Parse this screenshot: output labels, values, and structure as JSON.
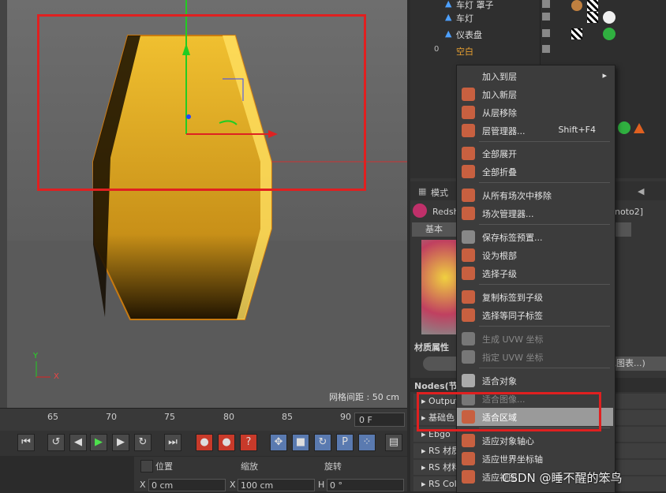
{
  "viewport": {
    "grid_spacing": "网格间距 : 50 cm",
    "axis_y": "Y",
    "axis_x": "X"
  },
  "timeline": {
    "ticks": [
      "65",
      "70",
      "75",
      "80",
      "85",
      "90"
    ],
    "frame": "0 F"
  },
  "coordinates": {
    "headers": [
      "位置",
      "缩放",
      "旋转"
    ],
    "fields": [
      {
        "axis": "X",
        "value": "0 cm"
      },
      {
        "axis": "X",
        "value": "100 cm"
      },
      {
        "axis": "H",
        "value": "0 °"
      }
    ]
  },
  "object_manager": {
    "rows": [
      "车灯 罩子",
      "车灯",
      "仪表盘",
      "空白"
    ],
    "null_badge": "0"
  },
  "attributes": {
    "mode_tab": "模式",
    "material_name": "Redsh",
    "tag_suffix": "noto2]",
    "basic_tab": "基本",
    "section_title": "材质属性",
    "button_right": "色图表...)",
    "nodes_header": "Nodes(节点",
    "rows": [
      "Output",
      "基础色",
      "Ebgo",
      "RS 材质",
      "RS 材料",
      "RS Colo"
    ]
  },
  "context_menu": {
    "items": [
      {
        "label": "加入到层",
        "submenu": true
      },
      {
        "label": "加入新层"
      },
      {
        "label": "从层移除"
      },
      {
        "label": "层管理器...",
        "shortcut": "Shift+F4"
      },
      {
        "label": "全部展开"
      },
      {
        "label": "全部折叠"
      },
      {
        "label": "从所有场次中移除"
      },
      {
        "label": "场次管理器..."
      },
      {
        "label": "保存标签预置..."
      },
      {
        "label": "设为根部"
      },
      {
        "label": "选择子级"
      },
      {
        "label": "复制标签到子级"
      },
      {
        "label": "选择等同子标签"
      },
      {
        "label": "生成 UVW 坐标",
        "disabled": true
      },
      {
        "label": "指定 UVW 坐标",
        "disabled": true
      },
      {
        "label": "适合对象"
      },
      {
        "label": "适合图像...",
        "disabled": true
      },
      {
        "label": "适合区域",
        "highlighted": true
      },
      {
        "label": "适应对象轴心"
      },
      {
        "label": "适应世界坐标轴"
      },
      {
        "label": "适应视图"
      }
    ]
  },
  "watermark": "CSDN @睡不醒的笨鸟",
  "colors": {
    "highlight_box": "#e02020",
    "object_yellow": "#e0a820",
    "menu_highlight": "#9a9a9a"
  }
}
